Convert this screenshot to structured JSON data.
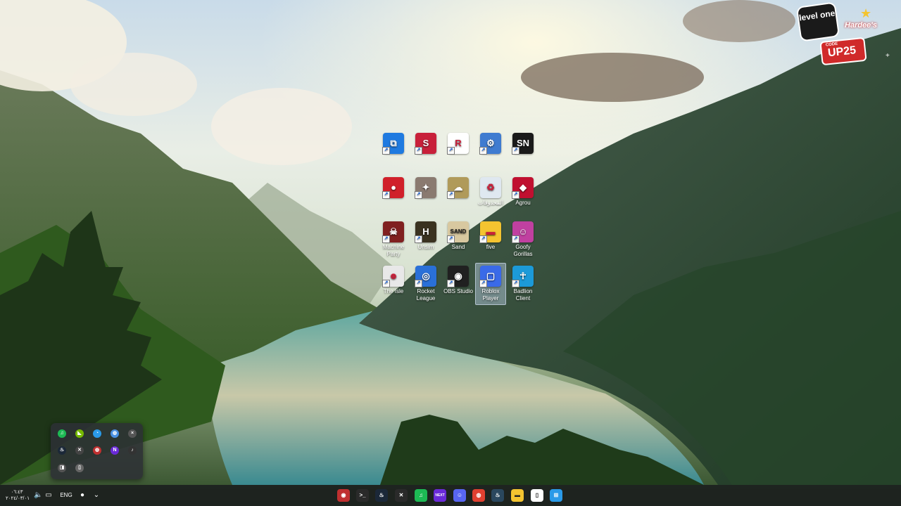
{
  "desktop": {
    "icons": [
      {
        "label": "",
        "icon": "screen-capture-icon",
        "color": "#1f7ae0"
      },
      {
        "label": "",
        "icon": "s-lightning-icon",
        "color": "#c8203a"
      },
      {
        "label": "",
        "icon": "r-logo-icon",
        "color": "#ffffff"
      },
      {
        "label": "",
        "icon": "device-tool-icon",
        "color": "#3f7bd0"
      },
      {
        "label": "",
        "icon": "sn-game-icon",
        "color": "#1a1a1a"
      },
      {
        "label": "",
        "icon": "red-car-icon",
        "color": "#d0202a"
      },
      {
        "label": "",
        "icon": "game-art-icon",
        "color": "#8a7a70"
      },
      {
        "label": "",
        "icon": "sketch-game-icon",
        "color": "#b09a5a"
      },
      {
        "label": "المحذوفات",
        "icon": "recycle-bin-icon",
        "color": "#dfe8f0"
      },
      {
        "label": "Agrou",
        "icon": "agrou-icon",
        "color": "#c01030"
      },
      {
        "label": "Machine Party",
        "icon": "machine-party-icon",
        "color": "#802020"
      },
      {
        "label": "Unsim",
        "icon": "shield-game-icon",
        "color": "#3a3220"
      },
      {
        "label": "Sand",
        "icon": "sand-icon",
        "color": "#d8c8a0"
      },
      {
        "label": "five",
        "icon": "folder-icon",
        "color": "#f4c430"
      },
      {
        "label": "Goofy Gorillas",
        "icon": "goofy-gorillas-icon",
        "color": "#c040a0"
      },
      {
        "label": "The Isle",
        "icon": "the-isle-icon",
        "color": "#e8e8e8"
      },
      {
        "label": "Rocket League",
        "icon": "rocket-league-icon",
        "color": "#2a70d8"
      },
      {
        "label": "OBS Studio",
        "icon": "obs-icon",
        "color": "#202020"
      },
      {
        "label": "Roblox Player",
        "icon": "roblox-icon",
        "color": "#3a6ae8"
      },
      {
        "label": "Badlion Client",
        "icon": "badlion-icon",
        "color": "#1c9ad8"
      }
    ],
    "glyphs": [
      "⧉",
      "S",
      "R",
      "⚙",
      "SN",
      "●",
      "✦",
      "☁",
      "♻",
      "◆",
      "☠",
      "H",
      "SAND",
      "▬",
      "☺",
      "☻",
      "◎",
      "◉",
      "▢",
      "☥"
    ]
  },
  "promo": {
    "brand_top": "level one",
    "brand_right": "Hardee's",
    "code_label": "CODE",
    "code": "UP25"
  },
  "tray_popup": {
    "icons": [
      "spotify-icon",
      "nvidia-icon",
      "edge-color-icon",
      "search-sync-icon",
      "close-small-icon",
      "steam-icon",
      "xbox-icon",
      "game-bar-icon",
      "next-icon",
      "headset-icon",
      "display-icon",
      "usb-icon"
    ],
    "glyphs": [
      "♫",
      "◣",
      "◔",
      "◍",
      "×",
      "♨",
      "✕",
      "◍",
      "N",
      "♪",
      "◨",
      "▯"
    ]
  },
  "taskbar": {
    "clock_time": "٠٦:٤٣",
    "clock_date": "٢٠٢٤/٠٣/٠١",
    "language": "ENG",
    "apps": [
      {
        "name": "recorder-app",
        "glyph": "◉",
        "color": "#c03030"
      },
      {
        "name": "terminal-app",
        "glyph": ">_",
        "color": "#2a2a2a"
      },
      {
        "name": "steam-app",
        "glyph": "♨",
        "color": "#1b2838"
      },
      {
        "name": "xbox-app",
        "glyph": "✕",
        "color": "#2a2a2a"
      },
      {
        "name": "spotify-app",
        "glyph": "♫",
        "color": "#1db954"
      },
      {
        "name": "next-app",
        "glyph": "NEXT",
        "color": "#6a2ad8"
      },
      {
        "name": "discord-app",
        "glyph": "☺",
        "color": "#5865f2"
      },
      {
        "name": "chrome-app",
        "glyph": "◍",
        "color": "#e04030"
      },
      {
        "name": "steam-app-2",
        "glyph": "♨",
        "color": "#2a475e"
      },
      {
        "name": "file-explorer-app",
        "glyph": "▬",
        "color": "#f4c430"
      },
      {
        "name": "notepad-app",
        "glyph": "▯",
        "color": "#ffffff"
      },
      {
        "name": "start-app",
        "glyph": "⊞",
        "color": "#2a9ae8"
      }
    ]
  }
}
